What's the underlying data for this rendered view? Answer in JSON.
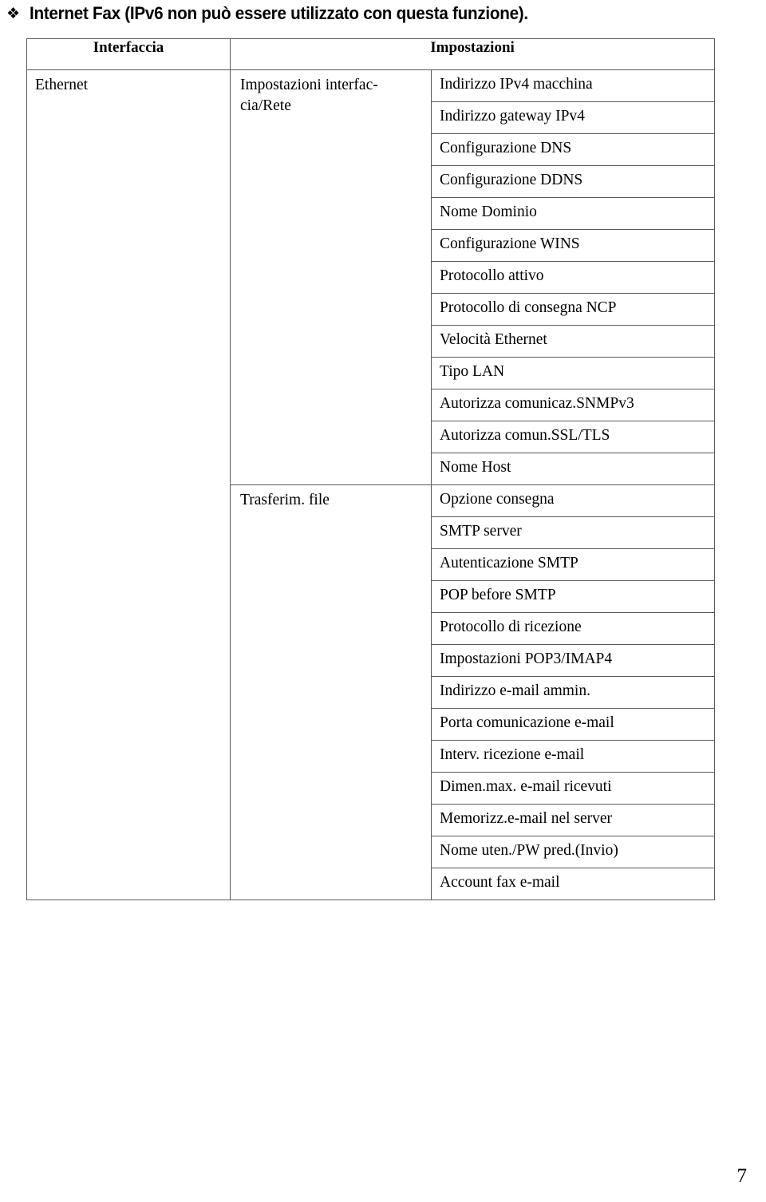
{
  "heading": {
    "bullet_icon": "diamond-bullet-icon",
    "bullet_glyph": "❖",
    "text": "Internet Fax (IPv6 non può essere utilizzato con questa funzione)."
  },
  "table": {
    "headers": {
      "interface": "Interfaccia",
      "settings": "Impostazioni"
    },
    "interface_label": "Ethernet",
    "groups": [
      {
        "label_line1": "Impostazioni interfac-",
        "label_line2": "cia/Rete",
        "settings": [
          "Indirizzo IPv4 macchina",
          "Indirizzo gateway IPv4",
          "Configurazione DNS",
          "Configurazione DDNS",
          "Nome Dominio",
          "Configurazione WINS",
          "Protocollo attivo",
          "Protocollo di consegna NCP",
          "Velocità Ethernet",
          "Tipo LAN",
          "Autorizza comunicaz.SNMPv3",
          "Autorizza comun.SSL/TLS",
          "Nome Host"
        ]
      },
      {
        "label_line1": "Trasferim. file",
        "label_line2": "",
        "settings": [
          "Opzione consegna",
          "SMTP server",
          "Autenticazione SMTP",
          "POP before SMTP",
          "Protocollo di ricezione",
          "Impostazioni POP3/IMAP4",
          "Indirizzo e-mail ammin.",
          "Porta comunicazione e-mail",
          "Interv. ricezione e-mail",
          "Dimen.max. e-mail ricevuti",
          "Memorizz.e-mail nel server",
          "Nome uten./PW pred.(Invio)",
          "Account fax e-mail"
        ]
      }
    ]
  },
  "footer": {
    "page_number": "7"
  }
}
